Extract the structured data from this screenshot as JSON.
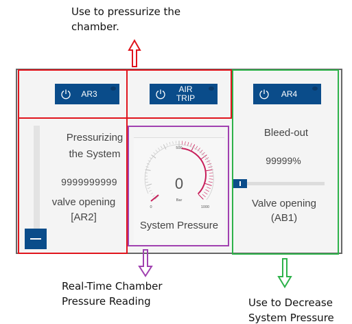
{
  "annotations": {
    "top": [
      "Use to pressurize the",
      "chamber."
    ],
    "bottom_left": [
      "Real-Time Chamber",
      "Pressure Reading"
    ],
    "bottom_right": [
      "Use to Decrease",
      "System Pressure"
    ]
  },
  "buttons": {
    "ar3": "AR3",
    "air_trip": [
      "AIR",
      "TRIP"
    ],
    "ar4": "AR4"
  },
  "left_section": {
    "title": [
      "Pressurizing",
      "the System"
    ],
    "value": "9999999999",
    "caption": [
      "valve opening",
      "[AR2]"
    ]
  },
  "gauge": {
    "value": "0",
    "unit": "Bar",
    "min_label": "0",
    "mid_label": "500",
    "max_label": "1000",
    "min": 0,
    "max": 1000,
    "label": "System Pressure"
  },
  "right_section": {
    "title": "Bleed-out",
    "value": "99999%",
    "caption": [
      "Valve opening",
      "(AB1)"
    ]
  },
  "sliders": {
    "ar2_level": 0,
    "ab1_level": 0
  },
  "colors": {
    "button_blue": "#0a4c8a",
    "annotation_red": "#e0141c",
    "annotation_purple": "#a040b0",
    "annotation_green": "#2db24a",
    "gauge_red_zone": "#c81e5a"
  },
  "icons": [
    "power-icon",
    "up-arrow-icon",
    "down-arrow-icon"
  ]
}
